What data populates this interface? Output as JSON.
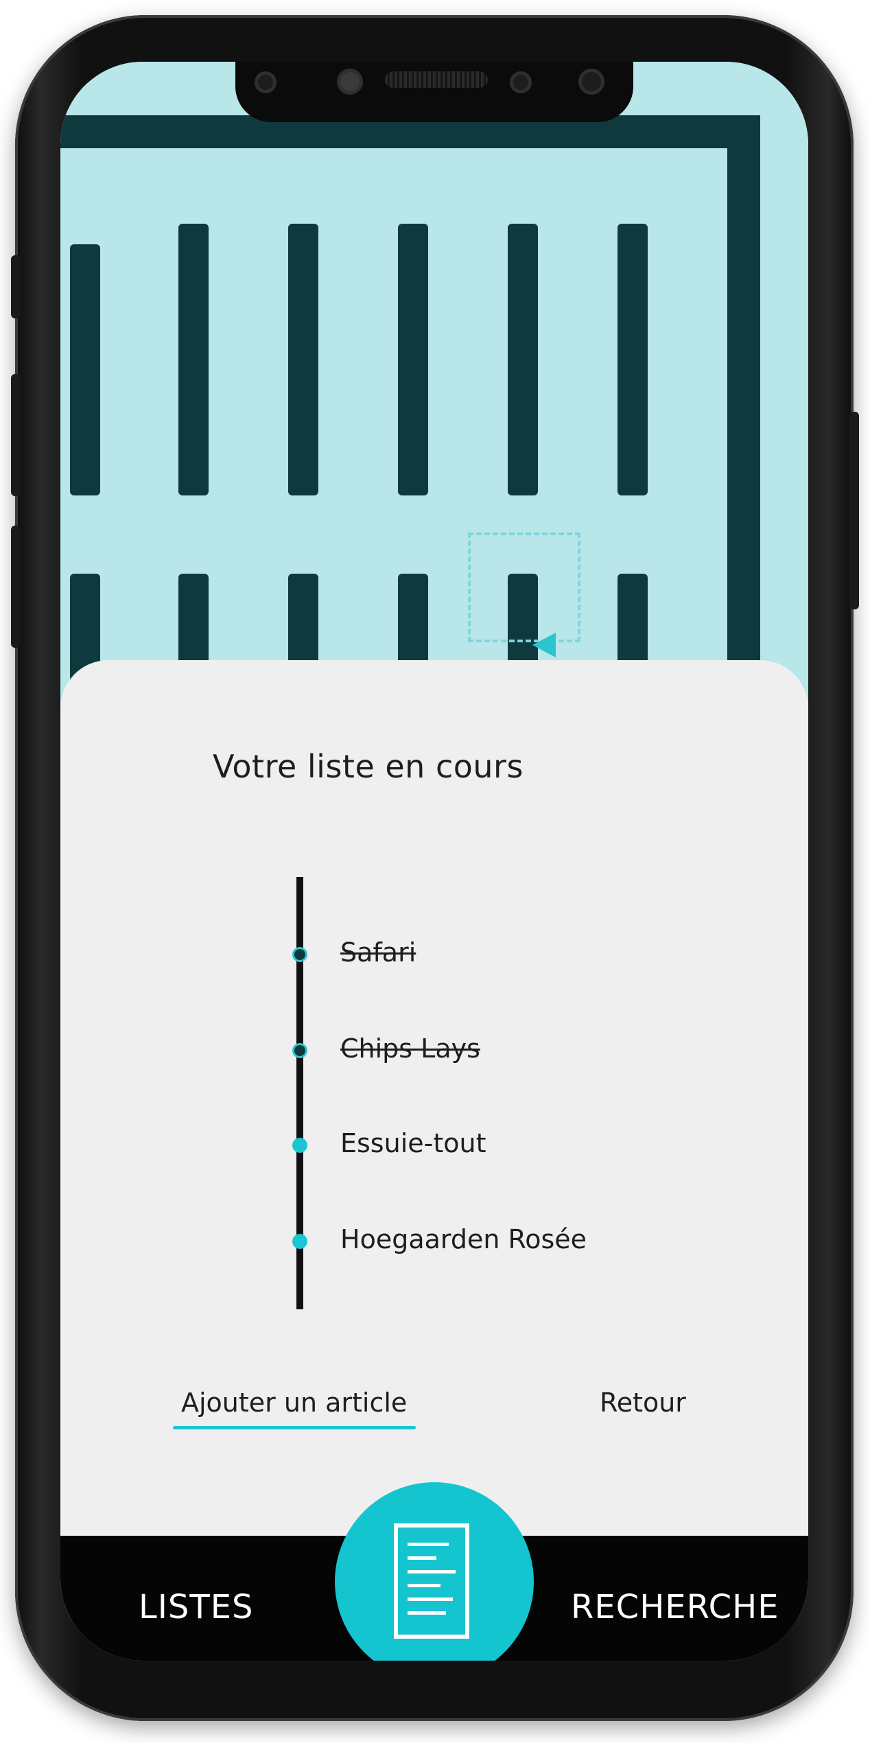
{
  "sheet": {
    "title": "Votre liste en cours",
    "items": [
      {
        "label": "Safari",
        "checked": true
      },
      {
        "label": "Chips Lays",
        "checked": true
      },
      {
        "label": "Essuie-tout",
        "checked": false
      },
      {
        "label": "Hoegaarden Rosée",
        "checked": false
      }
    ],
    "add_label": "Ajouter un article",
    "back_label": "Retour"
  },
  "tabbar": {
    "left_label": "LISTES",
    "right_label": "RECHERCHE",
    "center_icon": "document-list-icon"
  },
  "colors": {
    "accent": "#19c6d1",
    "map_background": "#b8e6e9",
    "shelf": "#0e3a3d",
    "sheet_background": "#efefef",
    "tabbar_background": "#050505"
  }
}
